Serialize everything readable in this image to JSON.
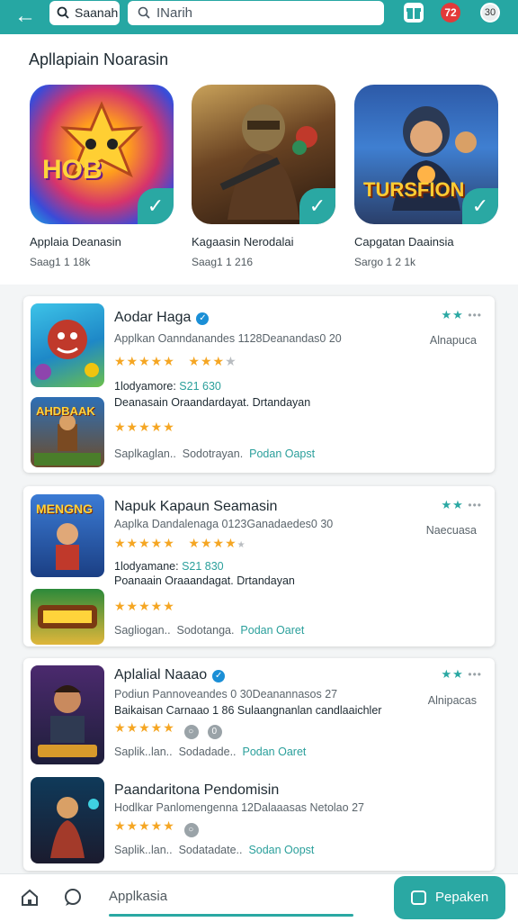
{
  "topbar": {
    "search_a": "Saanah",
    "search_b": "INarih",
    "badge": "72",
    "avatar_text": "30"
  },
  "featured": {
    "title": "Apllapiain Noarasin",
    "apps": [
      {
        "name": "Applaia Deanasin",
        "sub": "Saag1 1 18k",
        "icon_text": "HOB"
      },
      {
        "name": "Kagaasin Nerodalai",
        "sub": "Saag1 1 216",
        "icon_text": ""
      },
      {
        "name": "Capgatan Daainsia",
        "sub": "Sargo 1 2 1k",
        "icon_text": "TURSFION"
      }
    ]
  },
  "cards": [
    {
      "title": "Aodar Haga",
      "desc": "Applkan Oanndanandes 1128Deanandas0 20",
      "side": "Alnapuca",
      "meta_label": "1lodyamore:",
      "meta_value": "S21 630",
      "desc2": "Deanasain Oraandardayat. Drtandayan",
      "footer_a": "Saplkaglan..",
      "footer_b": "Sodotrayan.",
      "footer_link": "Podan Oapst",
      "thumb2_text": "AHDBAAK"
    },
    {
      "title": "Napuk Kapaun Seamasin",
      "desc": "Aaplka Dandalenaga 0123Ganadaedes0 30",
      "side": "Naecuasa",
      "meta_label": "1lodyamane:",
      "meta_value": "S21 830",
      "desc2": "Poanaain Oraaandagat. Drtandayan",
      "footer_a": "Sagliogan..",
      "footer_b": "Sodotanga.",
      "footer_link": "Podan Oaret",
      "thumb1_text": "MENGNG"
    },
    {
      "title": "Aplalial Naaao",
      "desc": "Podiun Pannoveandes 0 30Deanannasos 27",
      "side": "Alnipacas",
      "desc2": "Baikaisan Carnaao 1 86 Sulaangnanlan candlaaichler",
      "footer_a": "Saplik..lan..",
      "footer_b": "Sodadade..",
      "footer_link": "Podan Oaret",
      "title2": "Paandaritona Pendomisin",
      "desc3": "Hodlkar Panlomengenna 12Dalaaasas Netolao 27",
      "footer2_a": "Saplik..lan..",
      "footer2_b": "Sodatadate..",
      "footer2_link": "Sodan Oopst"
    }
  ],
  "bottombar": {
    "input": "Applkasia",
    "button": "Pepaken"
  }
}
